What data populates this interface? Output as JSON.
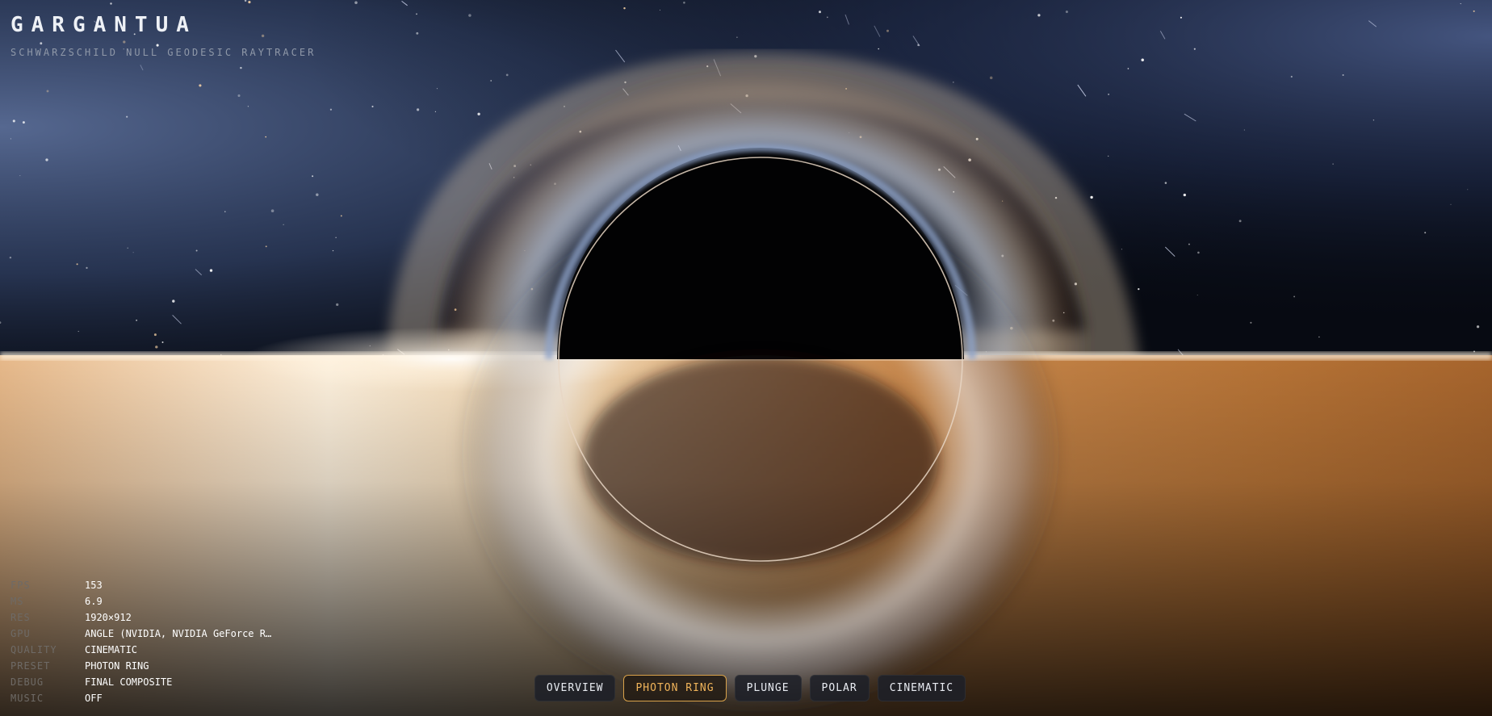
{
  "header": {
    "title": "GARGANTUA",
    "subtitle": "SCHWARZSCHILD NULL GEODESIC RAYTRACER"
  },
  "stats": [
    {
      "label": "FPS",
      "value": "153"
    },
    {
      "label": "MS",
      "value": "6.9"
    },
    {
      "label": "RES",
      "value": "1920×912"
    },
    {
      "label": "GPU",
      "value": "ANGLE (NVIDIA, NVIDIA GeForce R…"
    },
    {
      "label": "QUALITY",
      "value": "CINEMATIC"
    },
    {
      "label": "PRESET",
      "value": "PHOTON RING"
    },
    {
      "label": "DEBUG",
      "value": "FINAL COMPOSITE"
    },
    {
      "label": "MUSIC",
      "value": "OFF"
    }
  ],
  "presets": [
    {
      "label": "OVERVIEW",
      "active": false
    },
    {
      "label": "PHOTON RING",
      "active": true
    },
    {
      "label": "PLUNGE",
      "active": false
    },
    {
      "label": "POLAR",
      "active": false
    },
    {
      "label": "CINEMATIC",
      "active": false
    }
  ],
  "colors": {
    "accent": "#d9a24a",
    "accent_text": "#f0b45a",
    "disk_warm": "#c98a4a",
    "disk_hot": "#fff6e6",
    "sky_blue": "#3a4f78",
    "space": "#05070c"
  }
}
